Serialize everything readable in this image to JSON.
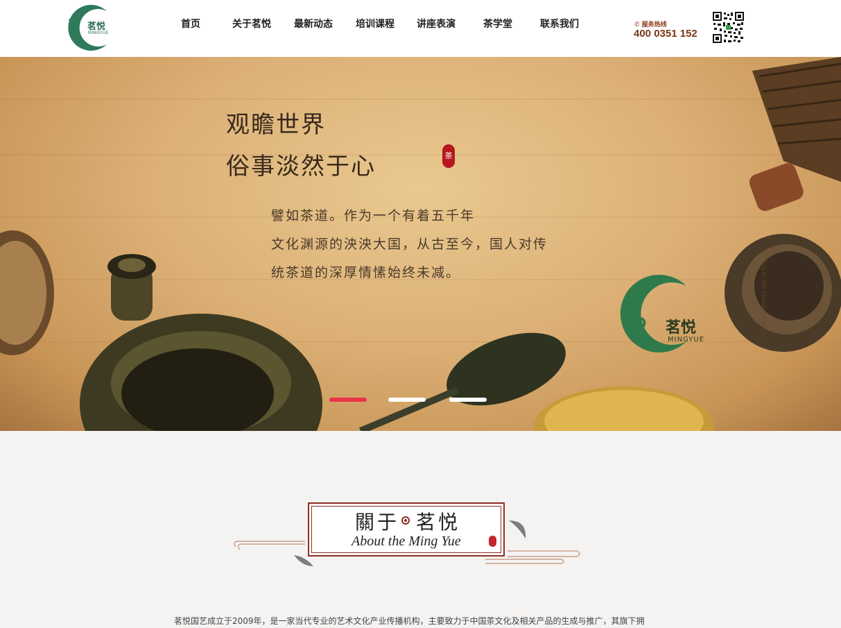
{
  "header": {
    "logo": {
      "name_cn": "茗悦",
      "name_en": "MINGYUE"
    },
    "nav": [
      {
        "label": "首页"
      },
      {
        "label": "关于茗悦"
      },
      {
        "label": "最新动态"
      },
      {
        "label": "培训课程"
      },
      {
        "label": "讲座表演"
      },
      {
        "label": "茶学堂"
      },
      {
        "label": "联系我们"
      }
    ],
    "hotline": {
      "label": "✆ 服务热线",
      "number": "400 0351 152"
    }
  },
  "banner": {
    "title_line1": "观瞻世界",
    "title_line2": "俗事淡然于心",
    "seal_char": "茶",
    "paragraph": [
      "譬如茶道。作为一个有着五千年",
      "文化渊源的泱泱大国，从古至今，国人对传",
      "统茶道的深厚情愫始终未减。"
    ],
    "logo": {
      "name_cn": "茗悦",
      "name_en": "MINGYUE"
    },
    "vertical_text": "fon in the classic · classic",
    "slides": 3,
    "active_slide": 1,
    "colors": {
      "active_dot": "#e8354a",
      "inactive_dot": "#ffffff"
    }
  },
  "about": {
    "title_cn_left": "關于",
    "title_cn_right": "茗悦",
    "title_en": "About the Ming Yue",
    "intro": "茗悦国艺成立于2009年，是一家当代专业的艺术文化产业传播机构，主要致力于中国茶文化及相关产品的生成与推广，其旗下拥"
  },
  "colors": {
    "brand_green": "#2e6f55",
    "seal_red": "#b5171e",
    "frame_brown": "#8a2f24"
  }
}
